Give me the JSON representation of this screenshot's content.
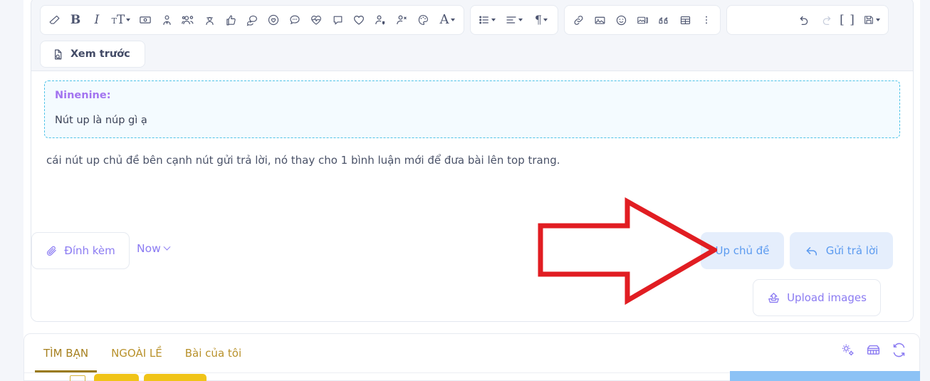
{
  "editor": {
    "toolbar": {
      "groups": [
        {
          "name": "format-group",
          "buttons": [
            {
              "icon": "eraser-icon",
              "label": "Xóa định dạng"
            },
            {
              "icon": "bold-icon",
              "label": "B"
            },
            {
              "icon": "italic-icon",
              "label": "I"
            },
            {
              "icon": "font-size-icon",
              "label": "TT",
              "caret": true
            },
            {
              "icon": "money-bill-icon",
              "label": "Tiền"
            },
            {
              "icon": "user-tie-icon",
              "label": "Người dùng"
            },
            {
              "icon": "users-icon",
              "label": "Nhóm"
            },
            {
              "icon": "user-secret-icon",
              "label": "Ẩn danh"
            },
            {
              "icon": "thumbs-up-icon",
              "label": "Thích"
            },
            {
              "icon": "comments-icon",
              "label": "Bình luận"
            },
            {
              "icon": "heart-circle-icon",
              "label": "Tim"
            },
            {
              "icon": "comment-dots-icon",
              "label": "Nhắn"
            },
            {
              "icon": "heart-pulse-icon",
              "label": "Nhịp tim"
            },
            {
              "icon": "comment-alt-icon",
              "label": "Ghi chú"
            },
            {
              "icon": "heart-icon",
              "label": "Yêu thích"
            },
            {
              "icon": "user-tag-icon",
              "label": "Gắn thẻ"
            },
            {
              "icon": "user-times-icon",
              "label": "Bỏ thẻ"
            },
            {
              "icon": "palette-icon",
              "label": "Màu nền"
            },
            {
              "icon": "text-color-icon",
              "label": "A",
              "caret": true
            }
          ]
        },
        {
          "name": "list-group",
          "buttons": [
            {
              "icon": "list-icon",
              "label": "Danh sách",
              "caret": true
            },
            {
              "icon": "align-icon",
              "label": "Căn lề",
              "caret": true
            },
            {
              "icon": "paragraph-icon",
              "label": "Đoạn",
              "caret": true
            }
          ]
        },
        {
          "name": "insert-group",
          "buttons": [
            {
              "icon": "link-icon",
              "label": "Chèn liên kết"
            },
            {
              "icon": "image-icon",
              "label": "Chèn ảnh"
            },
            {
              "icon": "smile-icon",
              "label": "Biểu tượng cảm xúc"
            },
            {
              "icon": "media-icon",
              "label": "Chèn media"
            },
            {
              "icon": "quote-icon",
              "label": "Trích dẫn"
            },
            {
              "icon": "table-icon",
              "label": "Bảng"
            },
            {
              "icon": "more-icon",
              "label": "Thêm"
            }
          ]
        },
        {
          "name": "history-group",
          "buttons": [
            {
              "icon": "undo-icon",
              "label": "Hoàn tác",
              "disabled": false
            },
            {
              "icon": "redo-icon",
              "label": "Làm lại",
              "disabled": true
            },
            {
              "icon": "bbcode-icon",
              "label": "[ ]"
            },
            {
              "icon": "save-icon",
              "label": "Lưu nháp",
              "caret": true
            }
          ]
        }
      ],
      "preview_label": "Xem trước",
      "preview_icon": "file-search-icon"
    },
    "content": {
      "quote_author": "Ninenine:",
      "quote_text": "Nút up là núp gì ạ",
      "body_text": "cái nút up chủ đề bên cạnh nút gửi trả lời, nó thay cho 1 bình luận mới để đưa bài lên top trang."
    },
    "footer": {
      "attach_label": "Đính kèm",
      "attach_icon": "paperclip-icon",
      "now_label": "Now",
      "now_icon": "chevron-down-icon",
      "up_topic_label": "Up chủ đề",
      "reply_label": "Gửi trả lời",
      "reply_icon": "reply-arrow-icon",
      "upload_label": "Upload images",
      "upload_icon": "upload-box-icon"
    }
  },
  "bottom_panel": {
    "tabs": [
      {
        "label": "TÌM BẠN",
        "active": true
      },
      {
        "label": "NGOÀI LỀ",
        "active": false
      },
      {
        "label": "Bài của tôi",
        "active": false
      }
    ],
    "icons": [
      {
        "name": "gears-settings-icon"
      },
      {
        "name": "store-shop-icon"
      },
      {
        "name": "refresh-sync-icon"
      }
    ]
  },
  "annotation": {
    "arrow_name": "red-callout-arrow",
    "arrow_color": "#e11d22",
    "points_to": "Up chủ đề"
  },
  "colors": {
    "accent_purple": "#8b7bf2",
    "accent_blue": "#5c9bf0",
    "accent_blue_bg": "#e5eefc",
    "quote_border": "#4ec3e8",
    "quote_bg": "#f4fbff",
    "quote_author": "#a374f0",
    "tab_gold": "#b8912b",
    "annotation_red": "#e11d22",
    "toolbar_bg": "#f4f6fa",
    "icon_gray": "#4d5570"
  }
}
